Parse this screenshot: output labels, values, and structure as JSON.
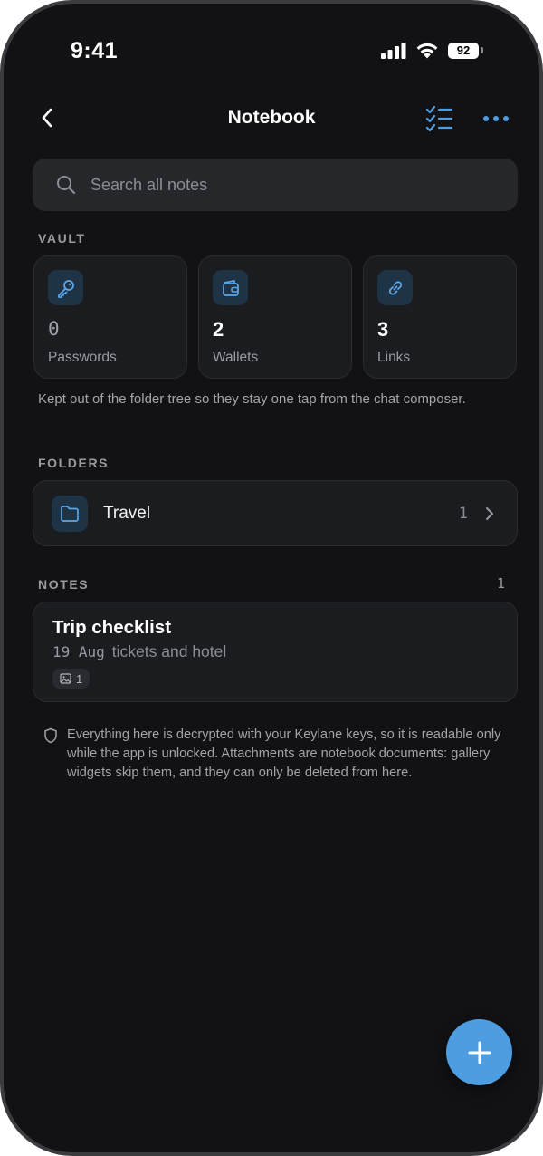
{
  "status_bar": {
    "time": "9:41",
    "battery_level": "92"
  },
  "nav": {
    "title": "Notebook",
    "back_icon": "chevron-left-icon",
    "checklist_icon": "checklist-icon",
    "more_icon": "more-horizontal-icon"
  },
  "search": {
    "placeholder": "Search all notes"
  },
  "vault": {
    "label": "VAULT",
    "items": [
      {
        "count": "0",
        "label": "Passwords",
        "icon": "key-icon"
      },
      {
        "count": "2",
        "label": "Wallets",
        "icon": "wallet-icon"
      },
      {
        "count": "3",
        "label": "Links",
        "icon": "link-icon"
      }
    ],
    "caption": "Kept out of the folder tree so they stay one tap from the chat composer."
  },
  "folders": {
    "label": "FOLDERS",
    "items": [
      {
        "name": "Travel",
        "count": "1",
        "icon": "folder-icon"
      }
    ]
  },
  "notes": {
    "label": "NOTES",
    "count": "1",
    "items": [
      {
        "title": "Trip checklist",
        "date": "19 Aug",
        "preview": "tickets and hotel",
        "attachments": "1"
      }
    ]
  },
  "footer": {
    "text": "Everything here is decrypted with your Keylane keys, so it is readable only while the app is unlocked. Attachments are notebook documents: gallery widgets skip them, and they can only be deleted from here."
  },
  "colors": {
    "accent": "#4e9de0",
    "background": "#121215",
    "card": "#1b1c20"
  }
}
